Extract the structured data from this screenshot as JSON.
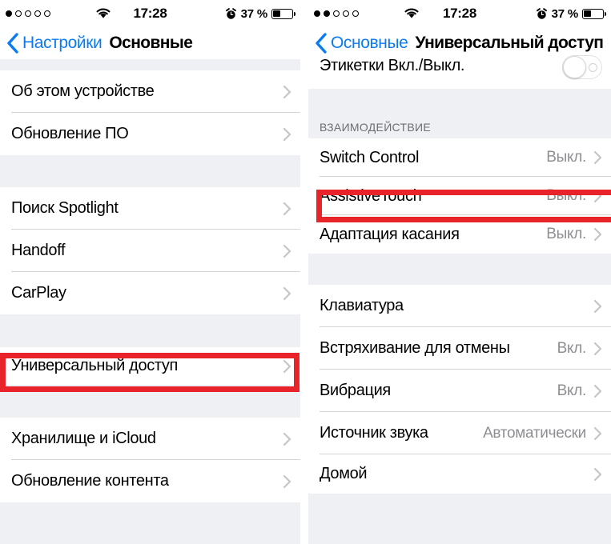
{
  "accent_blue": "#0b7bf0",
  "highlight_red": "#e8232a",
  "value_gray": "#8e8e93",
  "left_screen": {
    "statusbar": {
      "signal_dots_total": 5,
      "signal_dots_filled": 1,
      "wifi_icon": "wifi-icon",
      "time": "17:28",
      "alarm_icon": "alarm-clock-icon",
      "battery_percent": "37 %",
      "battery_level": 37
    },
    "navbar": {
      "back_icon": "back-chevron-icon",
      "back_label": "Настройки",
      "title": "Основные"
    },
    "groups": [
      {
        "rows": [
          {
            "label": "Об этом устройстве",
            "value": "",
            "accessory": "chevron-right-icon"
          },
          {
            "label": "Обновление ПО",
            "value": "",
            "accessory": "chevron-right-icon"
          }
        ]
      },
      {
        "rows": [
          {
            "label": "Поиск Spotlight",
            "value": "",
            "accessory": "chevron-right-icon"
          },
          {
            "label": "Handoff",
            "value": "",
            "accessory": "chevron-right-icon"
          },
          {
            "label": "CarPlay",
            "value": "",
            "accessory": "chevron-right-icon"
          }
        ]
      },
      {
        "rows": [
          {
            "label": "Универсальный доступ",
            "value": "",
            "accessory": "chevron-right-icon",
            "highlighted": true
          }
        ]
      },
      {
        "rows": [
          {
            "label": "Хранилище и iCloud",
            "value": "",
            "accessory": "chevron-right-icon"
          },
          {
            "label": "Обновление контента",
            "value": "",
            "accessory": "chevron-right-icon"
          }
        ]
      }
    ]
  },
  "right_screen": {
    "statusbar": {
      "signal_dots_total": 5,
      "signal_dots_filled": 2,
      "wifi_icon": "wifi-icon",
      "time": "17:28",
      "alarm_icon": "alarm-clock-icon",
      "battery_percent": "37 %",
      "battery_level": 37
    },
    "navbar": {
      "back_icon": "back-chevron-icon",
      "back_label": "Основные",
      "title": "Универсальный доступ"
    },
    "top_row": {
      "label": "Этикетки Вкл./Выкл.",
      "toggle_state": "off"
    },
    "section_header": "ВЗАИМОДЕЙСТВИЕ",
    "groups": [
      {
        "rows": [
          {
            "label": "Switch Control",
            "value": "Выкл.",
            "accessory": "chevron-right-icon"
          },
          {
            "label": "AssistiveTouch",
            "value": "Выкл.",
            "accessory": "chevron-right-icon",
            "highlighted": true
          },
          {
            "label": "Адаптация касания",
            "value": "Выкл.",
            "accessory": "chevron-right-icon"
          }
        ]
      },
      {
        "rows": [
          {
            "label": "Клавиатура",
            "value": "",
            "accessory": "chevron-right-icon"
          },
          {
            "label": "Встряхивание для отмены",
            "value": "Вкл.",
            "accessory": "chevron-right-icon"
          },
          {
            "label": "Вибрация",
            "value": "Вкл.",
            "accessory": "chevron-right-icon"
          },
          {
            "label": "Источник звука",
            "value": "Автоматически",
            "accessory": "chevron-right-icon"
          },
          {
            "label": "Домой",
            "value": "",
            "accessory": "chevron-right-icon"
          }
        ]
      }
    ]
  }
}
